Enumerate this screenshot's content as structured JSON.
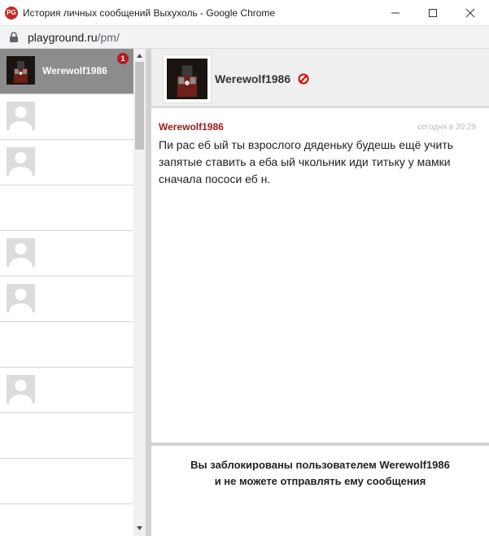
{
  "window": {
    "icon_text": "PG",
    "title": "История личных сообщений Выхухоль - Google Chrome"
  },
  "address": {
    "host": "playground.ru",
    "path": "/pm/"
  },
  "contacts": [
    {
      "name": "Werewolf1986",
      "unread": "1",
      "active": true
    },
    {
      "name": "",
      "avatar": "placeholder"
    },
    {
      "name": "",
      "avatar": "placeholder"
    },
    {
      "name": "",
      "avatar": "none"
    },
    {
      "name": "",
      "avatar": "placeholder"
    },
    {
      "name": "",
      "avatar": "placeholder"
    },
    {
      "name": "",
      "avatar": "none"
    },
    {
      "name": "",
      "avatar": "placeholder"
    },
    {
      "name": "",
      "avatar": "none"
    },
    {
      "name": "",
      "avatar": "none"
    }
  ],
  "chat": {
    "partner_name": "Werewolf1986",
    "message": {
      "author": "Werewolf1986",
      "time": "сегодня в 20:29",
      "text": "Пи     рас еб     ый ты взрослого дяденьку будешь ещё учить запятые ставить а еба     ый чкольник иди титьку у мамки сначала пососи еб     н."
    },
    "blocked_line1": "Вы заблокированы пользователем Werewolf1986",
    "blocked_line2": "и не можете отправлять ему сообщения"
  },
  "colors": {
    "accent": "#9b1b1b",
    "badge": "#b71c1c",
    "active_row": "#8c8c8c"
  }
}
